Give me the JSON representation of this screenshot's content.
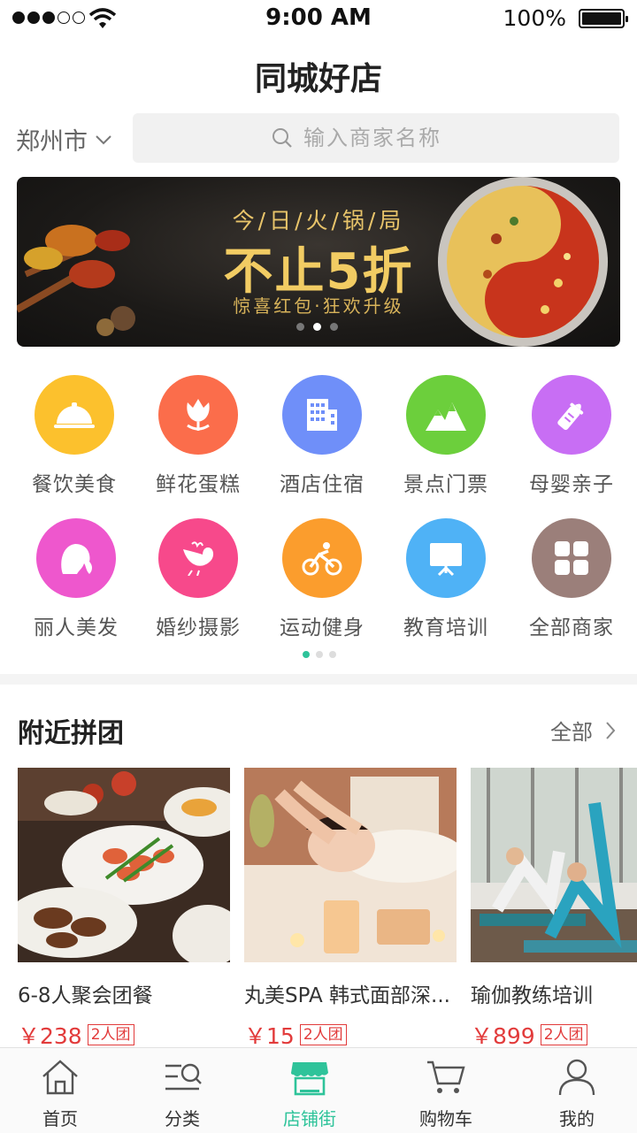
{
  "status_bar": {
    "time": "9:00 AM",
    "battery": "100%"
  },
  "header": {
    "title": "同城好店",
    "city": "郑州市",
    "search_placeholder": "输入商家名称"
  },
  "banner": {
    "line1": "今/日/火/锅/局",
    "line2": "不止5折",
    "line3": "惊喜红包·狂欢升级"
  },
  "categories": [
    {
      "label": "餐饮美食",
      "icon": "food-cloche-icon",
      "color": "#fcc12d"
    },
    {
      "label": "鲜花蛋糕",
      "icon": "flower-icon",
      "color": "#fb6d4b"
    },
    {
      "label": "酒店住宿",
      "icon": "hotel-icon",
      "color": "#6f8ff9"
    },
    {
      "label": "景点门票",
      "icon": "mountain-icon",
      "color": "#6ccf3c"
    },
    {
      "label": "母婴亲子",
      "icon": "baby-bottle-icon",
      "color": "#c86ef4"
    },
    {
      "label": "丽人美发",
      "icon": "woman-head-icon",
      "color": "#ee57cd"
    },
    {
      "label": "婚纱摄影",
      "icon": "bird-icon",
      "color": "#f7498b"
    },
    {
      "label": "运动健身",
      "icon": "cyclist-icon",
      "color": "#fb9d2d"
    },
    {
      "label": "教育培训",
      "icon": "presentation-board-icon",
      "color": "#4fb2f6"
    },
    {
      "label": "全部商家",
      "icon": "grid-icon",
      "color": "#9b7f7a"
    }
  ],
  "nearby": {
    "title": "附近拼团",
    "more": "全部",
    "items": [
      {
        "name": "6-8人聚会团餐",
        "price": "￥238",
        "tag": "2人团"
      },
      {
        "name": "丸美SPA 韩式面部深...",
        "price": "￥15",
        "tag": "2人团"
      },
      {
        "name": "瑜伽教练培训",
        "price": "￥899",
        "tag": "2人团"
      }
    ]
  },
  "tabbar": [
    {
      "label": "首页",
      "icon": "home-icon"
    },
    {
      "label": "分类",
      "icon": "category-search-icon"
    },
    {
      "label": "店铺街",
      "icon": "shop-icon",
      "active": true
    },
    {
      "label": "购物车",
      "icon": "cart-icon"
    },
    {
      "label": "我的",
      "icon": "user-icon"
    }
  ],
  "colors": {
    "accent": "#2ec39a",
    "price": "#e23b3b"
  }
}
